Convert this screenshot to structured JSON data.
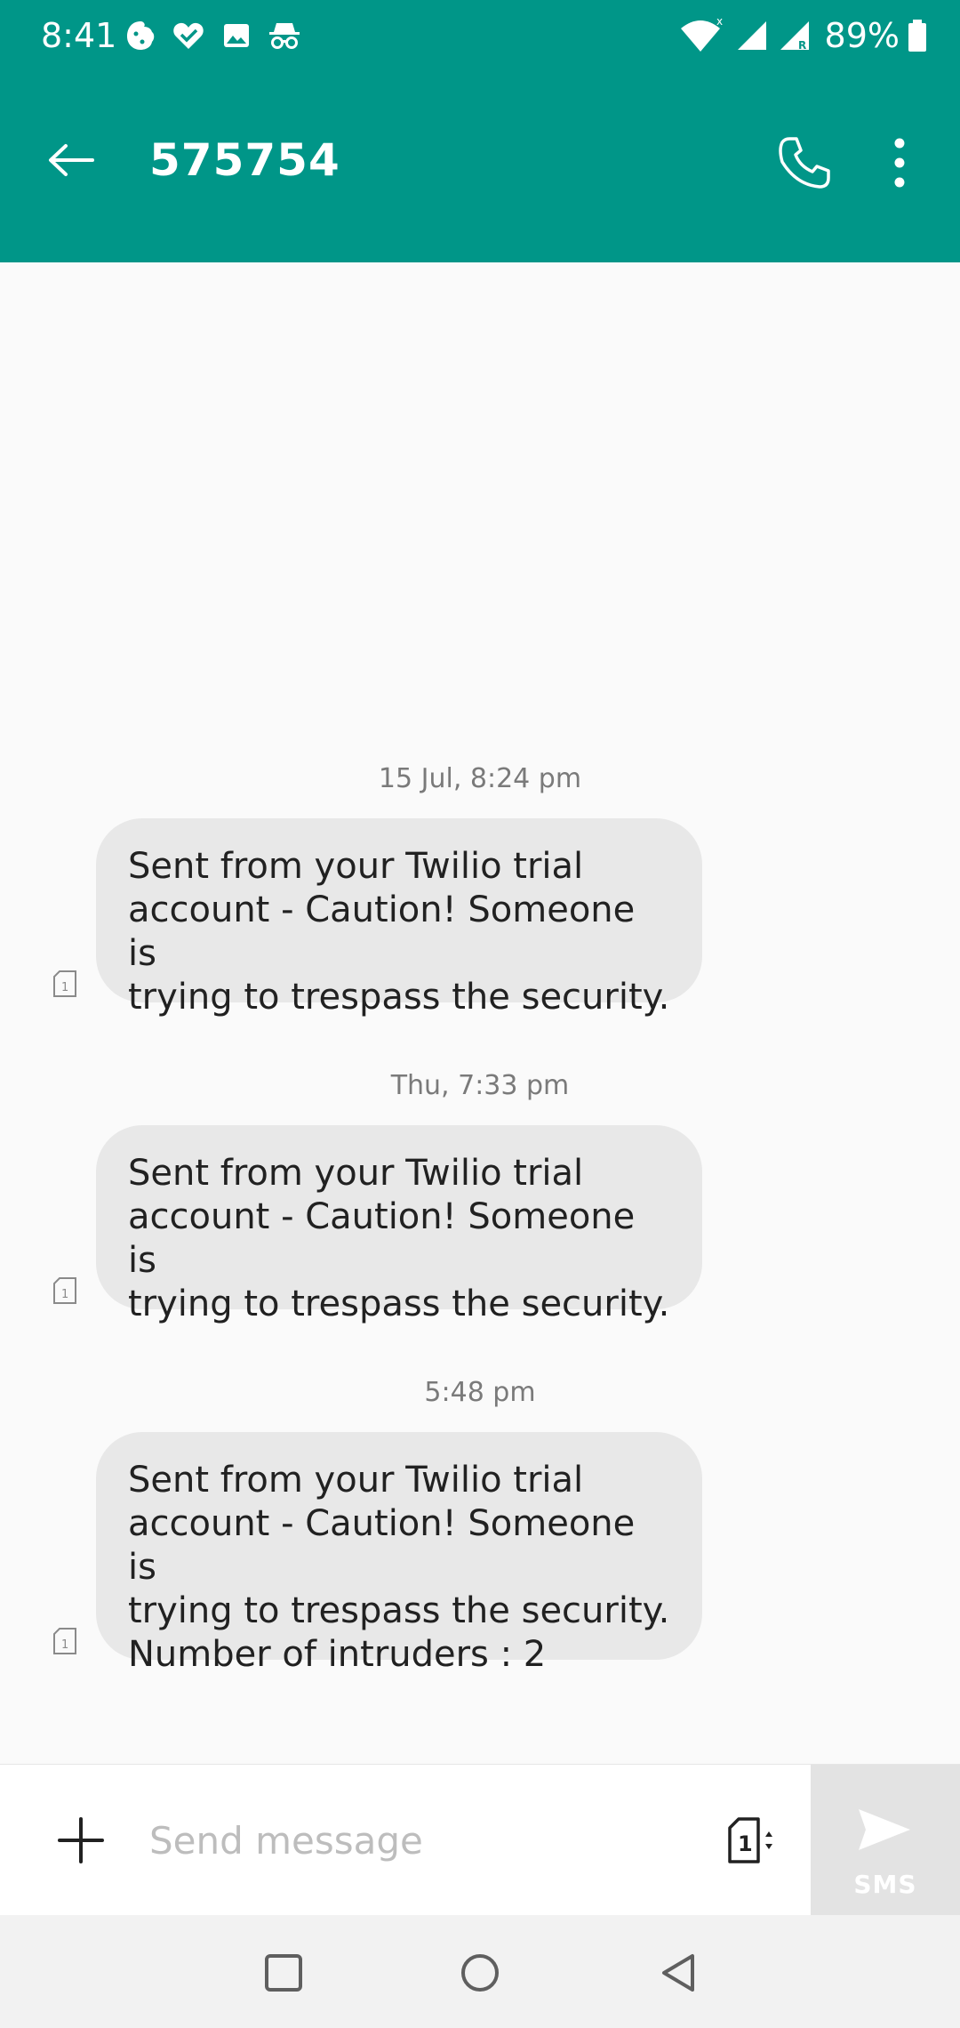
{
  "status_bar": {
    "time": "8:41",
    "battery": "89%",
    "notification_icons": [
      "cookie-icon",
      "heart-check-icon",
      "image-icon",
      "incognito-icon"
    ],
    "signal_icons": [
      "wifi-icon",
      "cellular-signal-icon",
      "roaming-signal-icon",
      "battery-icon"
    ]
  },
  "app_bar": {
    "title": "575754",
    "color": "#009688"
  },
  "conversation": {
    "messages": [
      {
        "timestamp": "15 Jul, 8:24 pm",
        "text": "Sent from your Twilio trial\naccount - Caution! Someone is\ntrying to trespass the security.",
        "sim": "1"
      },
      {
        "timestamp": "Thu, 7:33 pm",
        "text": "Sent from your Twilio trial\naccount - Caution! Someone is\ntrying to trespass the security.",
        "sim": "1"
      },
      {
        "timestamp": "5:48 pm",
        "text": "Sent from your Twilio trial\naccount - Caution! Someone is\ntrying to trespass the security.\nNumber of intruders : 2",
        "sim": "1"
      }
    ]
  },
  "compose": {
    "placeholder": "Send message",
    "sim_slot": "1",
    "send_label": "SMS"
  }
}
